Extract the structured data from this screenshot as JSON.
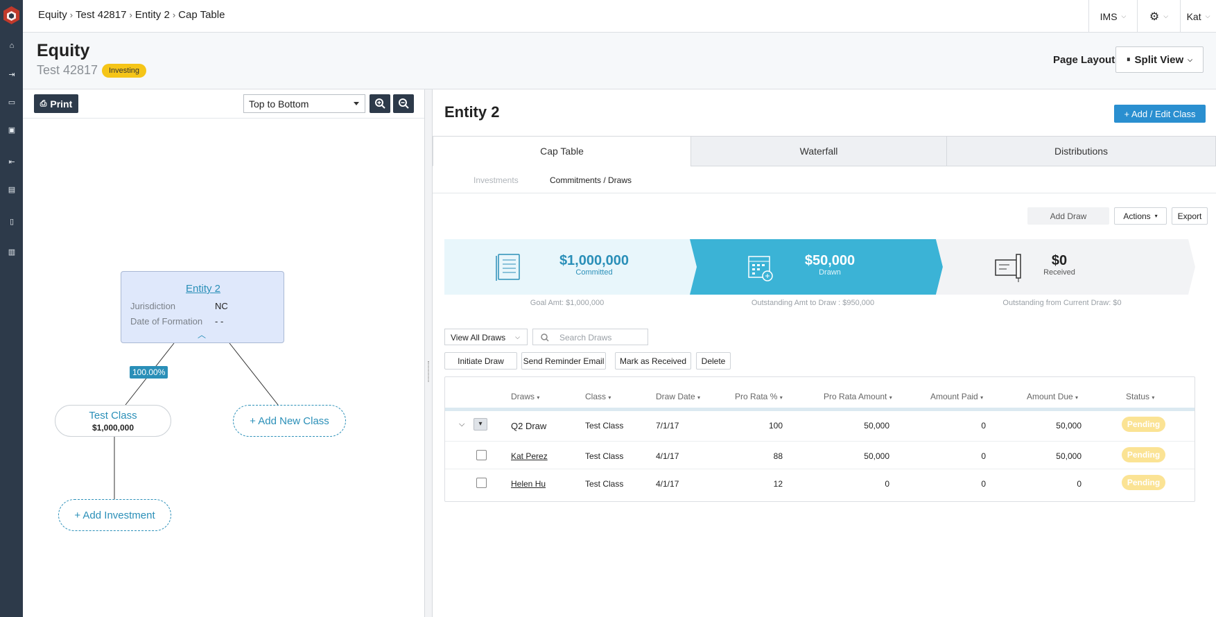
{
  "breadcrumb": [
    "Equity",
    "Test 42817",
    "Entity 2",
    "Cap Table"
  ],
  "topbar": {
    "ims_label": "IMS",
    "user_label": "Kat"
  },
  "page": {
    "title": "Equity",
    "subtitle": "Test 42817",
    "badge": "Investing",
    "layout_label": "Page Layout",
    "layout_value": "Split View"
  },
  "left": {
    "print_label": "Print",
    "orientation": "Top to Bottom",
    "entity": {
      "name": "Entity 2",
      "jurisdiction_label": "Jurisdiction",
      "jurisdiction": "NC",
      "formation_label": "Date of Formation",
      "formation": "- -"
    },
    "ownership_pct": "100.00%",
    "class_node": {
      "name": "Test Class",
      "amount": "$1,000,000"
    },
    "add_class_label": "+ Add New Class",
    "add_investment_label": "+ Add Investment"
  },
  "right": {
    "title": "Entity 2",
    "add_edit_label": "+ Add / Edit Class",
    "tabs": [
      "Cap Table",
      "Waterfall",
      "Distributions"
    ],
    "subtabs": [
      "Investments",
      "Commitments / Draws"
    ],
    "add_draw": "Add Draw",
    "actions": "Actions",
    "export": "Export",
    "summary": [
      {
        "amount": "$1,000,000",
        "label": "Committed",
        "note": "Goal Amt: $1,000,000"
      },
      {
        "amount": "$50,000",
        "label": "Drawn",
        "note": "Outstanding Amt to Draw : $950,000"
      },
      {
        "amount": "$0",
        "label": "Received",
        "note": "Outstanding from Current Draw: $0"
      }
    ],
    "view_filter": "View All Draws",
    "search_placeholder": "Search Draws",
    "bulk": [
      "Initiate Draw",
      "Send Reminder Email",
      "Mark as Received",
      "Delete"
    ],
    "columns": [
      "Draws",
      "Class",
      "Draw Date",
      "Pro Rata %",
      "Pro Rata Amount",
      "Amount Paid",
      "Amount Due",
      "Status"
    ],
    "rows": [
      {
        "draw": "Q2 Draw",
        "class": "Test Class",
        "date": "7/1/17",
        "pct": "100",
        "amount": "50,000",
        "paid": "0",
        "due": "50,000",
        "status": "Pending"
      },
      {
        "draw": "Kat Perez",
        "class": "Test Class",
        "date": "4/1/17",
        "pct": "88",
        "amount": "50,000",
        "paid": "0",
        "due": "50,000",
        "status": "Pending"
      },
      {
        "draw": "Helen Hu",
        "class": "Test Class",
        "date": "4/1/17",
        "pct": "12",
        "amount": "0",
        "paid": "0",
        "due": "0",
        "status": "Pending"
      }
    ]
  },
  "colors": {
    "rail": "#2d3a4a",
    "accent": "#2a8fb8",
    "button_blue": "#2a8fd0",
    "badge": "#f5c518",
    "pending": "#fbe394",
    "drawn_band": "#3bb3d6",
    "committed_band": "#e8f6fb"
  }
}
